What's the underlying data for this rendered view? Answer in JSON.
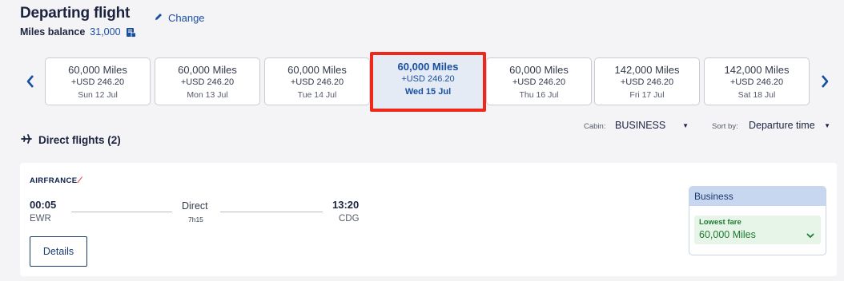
{
  "header": {
    "title": "Departing flight",
    "miles_label": "Miles balance",
    "miles_value": "31,000",
    "change_label": "Change"
  },
  "dates": [
    {
      "miles": "60,000 Miles",
      "usd": "+USD 246.20",
      "day": "Sun 12 Jul",
      "selected": false
    },
    {
      "miles": "60,000 Miles",
      "usd": "+USD 246.20",
      "day": "Mon 13 Jul",
      "selected": false
    },
    {
      "miles": "60,000 Miles",
      "usd": "+USD 246.20",
      "day": "Tue 14 Jul",
      "selected": false
    },
    {
      "miles": "60,000 Miles",
      "usd": "+USD 246.20",
      "day": "Wed 15 Jul",
      "selected": true
    },
    {
      "miles": "60,000 Miles",
      "usd": "+USD 246.20",
      "day": "Thu 16 Jul",
      "selected": false
    },
    {
      "miles": "142,000 Miles",
      "usd": "+USD 246.20",
      "day": "Fri 17 Jul",
      "selected": false
    },
    {
      "miles": "142,000 Miles",
      "usd": "+USD 246.20",
      "day": "Sat 18 Jul",
      "selected": false
    }
  ],
  "filters": {
    "cabin_label": "Cabin:",
    "cabin_value": "BUSINESS",
    "sort_label": "Sort by:",
    "sort_value": "Departure time"
  },
  "direct_heading": "Direct flights (2)",
  "flight": {
    "airline": "AIRFRANCE",
    "dep_time": "00:05",
    "dep_code": "EWR",
    "stop_label": "Direct",
    "duration": "7h15",
    "arr_time": "13:20",
    "arr_code": "CDG",
    "details_label": "Details",
    "fare": {
      "cabin": "Business",
      "tag": "Lowest fare",
      "miles": "60,000 Miles"
    }
  },
  "colors": {
    "accent": "#1a4fa0",
    "selected_border": "#f0281c",
    "fare_green": "#1f7a32"
  }
}
